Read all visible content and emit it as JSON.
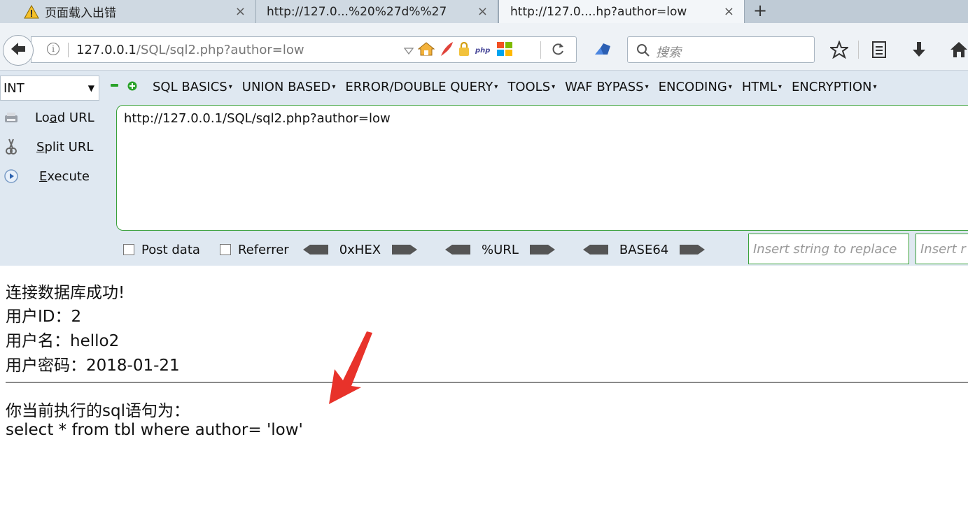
{
  "tabs": [
    {
      "title": "页面载入出错",
      "close": "×"
    },
    {
      "title": "http://127.0...%20%27d%%27",
      "close": "×"
    },
    {
      "title": "http://127.0....hp?author=low",
      "close": "×"
    }
  ],
  "new_tab": "+",
  "navbar": {
    "url_host": "127.0.0.1",
    "url_path": "/SQL/sql2.php?author=low",
    "search_placeholder": "搜索"
  },
  "hackbar": {
    "select_value": "INT",
    "menu": [
      "SQL BASICS",
      "UNION BASED",
      "ERROR/DOUBLE QUERY",
      "TOOLS",
      "WAF BYPASS",
      "ENCODING",
      "HTML",
      "ENCRYPTION"
    ],
    "load_url": {
      "pre": "Lo",
      "ul": "a",
      "post": "d URL"
    },
    "split_url": {
      "pre": "",
      "ul": "S",
      "post": "plit URL"
    },
    "execute": {
      "pre": "",
      "ul": "E",
      "post": "xecute"
    },
    "textarea_value": "http://127.0.0.1/SQL/sql2.php?author=low",
    "post_data_label": "Post data",
    "referrer_label": "Referrer",
    "encodings": [
      "0xHEX",
      "%URL",
      "BASE64"
    ],
    "replace_placeholder": "Insert string to replace",
    "replace_with_placeholder": "Insert r"
  },
  "page": {
    "line1": "连接数据库成功!",
    "line2": "用户ID：2",
    "line3": "用户名：hello2",
    "line4": "用户密码：2018-01-21",
    "line5": "你当前执行的sql语句为：",
    "line6": "select * from tbl where author= 'low'"
  },
  "colors": {
    "tabstrip": "#bfcbd6",
    "hackbar_bg": "#dfe8f1",
    "hackbar_green": "#3aa13a",
    "annotation_red": "#e8322a"
  }
}
